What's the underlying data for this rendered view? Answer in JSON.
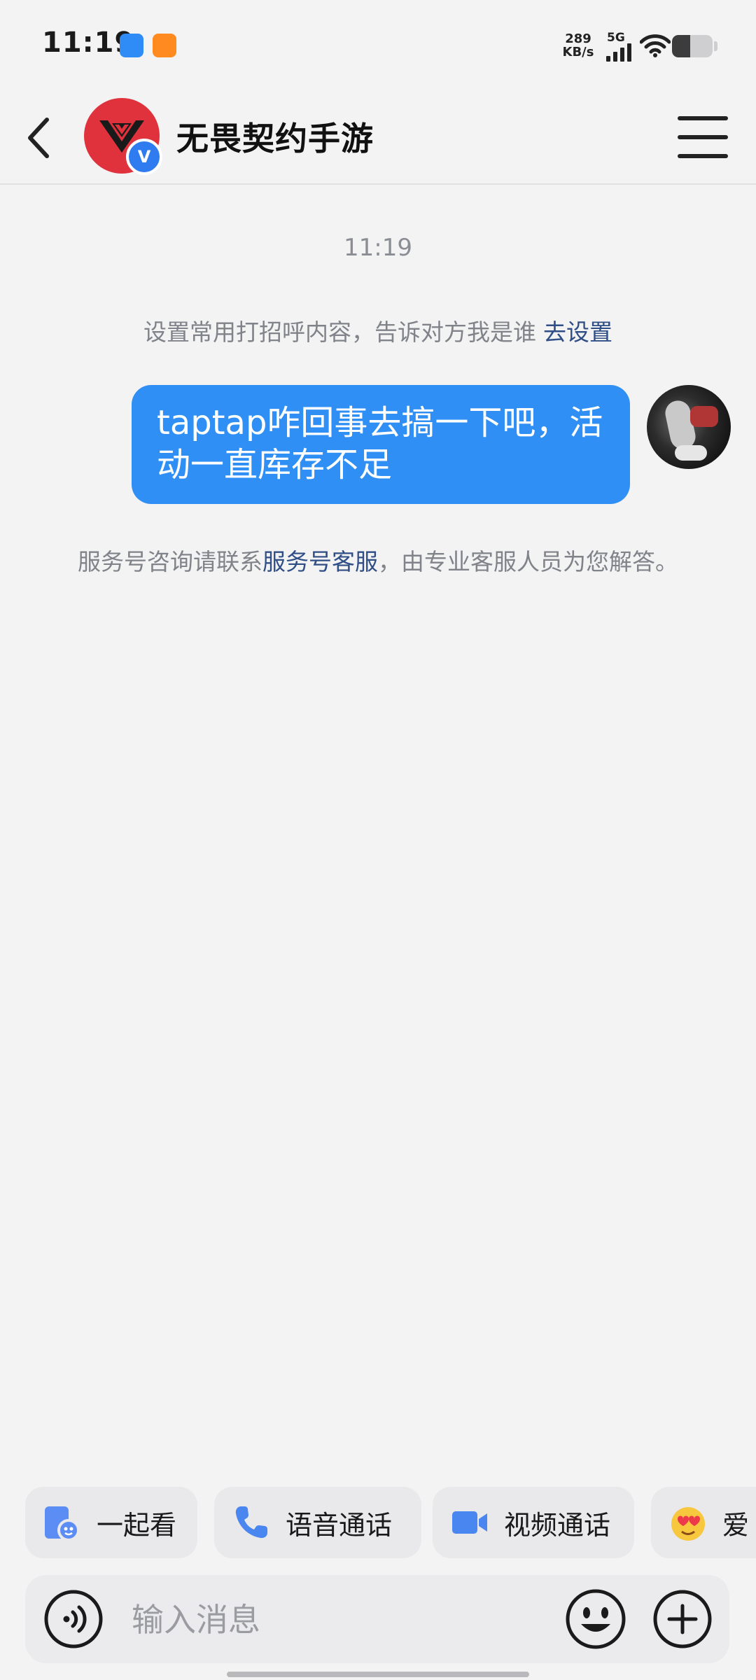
{
  "status_bar": {
    "time": "11:19",
    "net_speed_value": "289",
    "net_speed_unit": "KB/s",
    "network_type": "5G",
    "battery_level": 0.45,
    "app_icons": [
      "blue-app-icon",
      "taobao-flash-icon"
    ]
  },
  "header": {
    "title": "无畏契约手游",
    "verified_mark": "V"
  },
  "chat": {
    "timestamp": "11:19",
    "greeting_tip": "设置常用打招呼内容，告诉对方我是谁",
    "greeting_link": "去设置",
    "message_text": "taptap咋回事去搞一下吧，活动一直库存不足",
    "service_tip_prefix": "服务号咨询请联系",
    "service_tip_link": "服务号客服",
    "service_tip_suffix": "，由专业客服人员为您解答。"
  },
  "quick_actions": [
    {
      "label": "一起看",
      "icon": "watch-together-icon"
    },
    {
      "label": "语音通话",
      "icon": "phone-icon"
    },
    {
      "label": "视频通话",
      "icon": "video-camera-icon"
    },
    {
      "label": "爱",
      "icon": "heart-eyes-emoji-icon"
    }
  ],
  "input": {
    "placeholder": "输入消息",
    "value": ""
  },
  "colors": {
    "bubble": "#2f8ff4",
    "link": "#304e86",
    "avatar_red": "#e0323c",
    "verified_blue": "#2f7bf0",
    "background": "#f3f3f4"
  }
}
